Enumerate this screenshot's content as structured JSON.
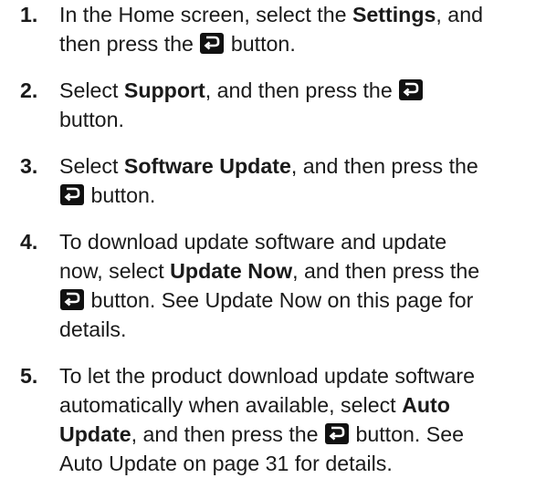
{
  "icons": {
    "enter": "enter-button-icon"
  },
  "steps": [
    {
      "number": "1.",
      "line1_a": "In the Home screen, select the ",
      "line1_bold": "Settings",
      "line1_b": ", and",
      "line2_a": "then press the ",
      "line2_b": " button."
    },
    {
      "number": "2.",
      "line1_a": "Select ",
      "line1_bold": "Support",
      "line1_b": ", and then press the ",
      "line2": "button."
    },
    {
      "number": "3.",
      "line1_a": "Select ",
      "line1_bold": "Software Update",
      "line1_b": ", and then press the",
      "line2_b": " button."
    },
    {
      "number": "4.",
      "line1": "To download update software and update",
      "line2_a": "now, select ",
      "line2_bold": "Update Now",
      "line2_b": ", and then press the",
      "line3_b": " button. See Update Now on this page for",
      "line4": "details."
    },
    {
      "number": "5.",
      "line1": "To let the product download update software",
      "line2_a": "automatically when available, select ",
      "line2_bold": "Auto",
      "line3_bold": "Update",
      "line3_a": ", and then press the ",
      "line3_b": " button. See",
      "line4": "Auto Update on page 31 for details."
    }
  ]
}
